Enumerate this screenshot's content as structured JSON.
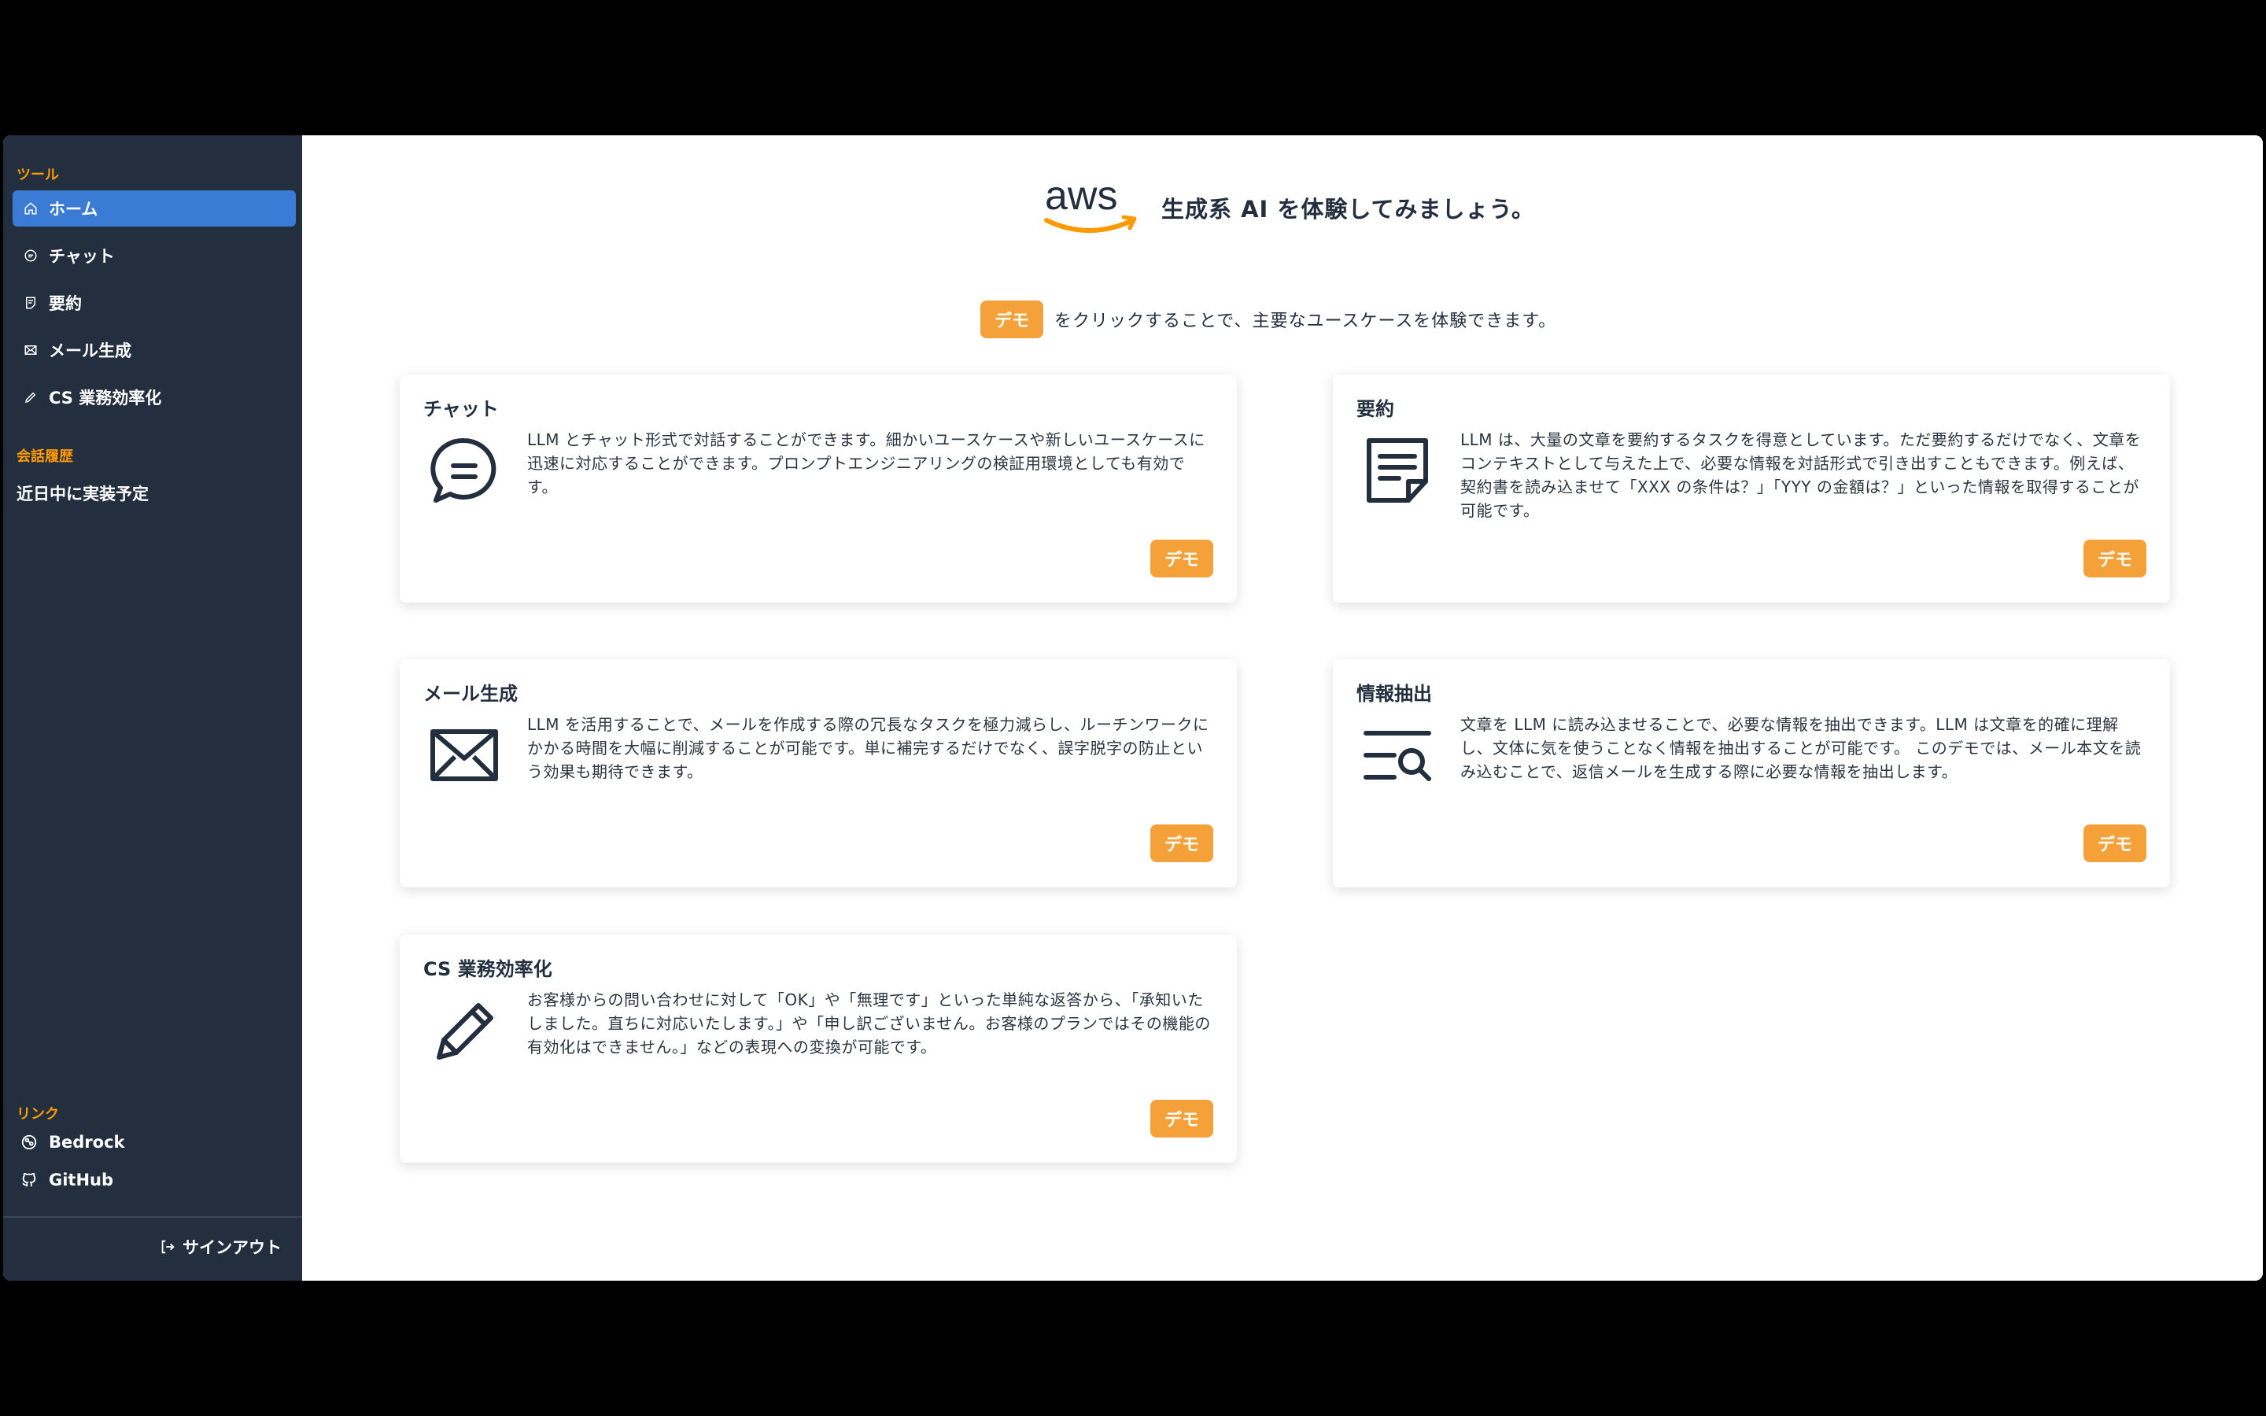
{
  "sidebar": {
    "tools_label": "ツール",
    "nav": [
      {
        "label": "ホーム",
        "icon": "home-icon",
        "active": true
      },
      {
        "label": "チャット",
        "icon": "chat-icon"
      },
      {
        "label": "要約",
        "icon": "summary-icon"
      },
      {
        "label": "メール生成",
        "icon": "mail-icon"
      },
      {
        "label": "CS 業務効率化",
        "icon": "pencil-icon"
      }
    ],
    "history_label": "会話履歴",
    "history_text": "近日中に実装予定",
    "links_label": "リンク",
    "links": [
      {
        "label": "Bedrock",
        "icon": "bedrock-icon"
      },
      {
        "label": "GitHub",
        "icon": "github-icon"
      }
    ],
    "signout_label": "サインアウト"
  },
  "header": {
    "logo_text": "aws",
    "title": "生成系 AI を体験してみましょう。"
  },
  "intro": {
    "badge": "デモ",
    "text": "をクリックすることで、主要なユースケースを体験できます。"
  },
  "cards": [
    {
      "title": "チャット",
      "icon": "chat-bubble-icon",
      "description": "LLM とチャット形式で対話することができます。細かいユースケースや新しいユースケースに迅速に対応することができます。プロンプトエンジニアリングの検証用環境としても有効です。",
      "button": "デモ"
    },
    {
      "title": "要約",
      "icon": "document-icon",
      "description": "LLM は、大量の文章を要約するタスクを得意としています。ただ要約するだけでなく、文章をコンテキストとして与えた上で、必要な情報を対話形式で引き出すこともできます。例えば、契約書を読み込ませて「XXX の条件は？」「YYY の金額は？」といった情報を取得することが可能です。",
      "button": "デモ"
    },
    {
      "title": "メール生成",
      "icon": "envelope-icon",
      "description": "LLM を活用することで、メールを作成する際の冗長なタスクを極力減らし、ルーチンワークにかかる時間を大幅に削減することが可能です。単に補完するだけでなく、誤字脱字の防止という効果も期待できます。",
      "button": "デモ"
    },
    {
      "title": "情報抽出",
      "icon": "text-search-icon",
      "description": "文章を LLM に読み込ませることで、必要な情報を抽出できます。LLM は文章を的確に理解し、文体に気を使うことなく情報を抽出することが可能です。 このデモでは、メール本文を読み込むことで、返信メールを生成する際に必要な情報を抽出します。",
      "button": "デモ"
    },
    {
      "title": "CS 業務効率化",
      "icon": "pencil-large-icon",
      "description": "お客様からの問い合わせに対して「OK」や「無理です」といった単純な返答から、「承知いたしました。直ちに対応いたします。」や「申し訳ございません。お客様のプランではその機能の有効化はできません。」などの表現への変換が可能です。",
      "button": "デモ"
    }
  ],
  "colors": {
    "sidebar_bg": "#232f3e",
    "accent_orange": "#ff9900",
    "button_orange": "#f5a13a",
    "active_blue": "#3a7bd5"
  }
}
